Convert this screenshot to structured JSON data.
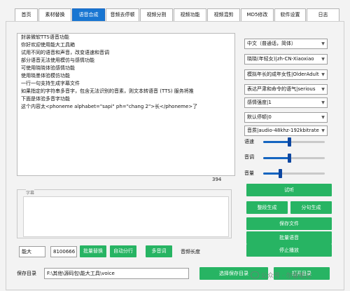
{
  "tabs": [
    {
      "label": "首页",
      "active": false
    },
    {
      "label": "素材替换",
      "active": false
    },
    {
      "label": "语音合成",
      "active": true
    },
    {
      "label": "音频去停顿",
      "active": false
    },
    {
      "label": "视频分割",
      "active": false
    },
    {
      "label": "视频功能",
      "active": false
    },
    {
      "label": "视频混剪",
      "active": false
    },
    {
      "label": "MD5修改",
      "active": false
    },
    {
      "label": "软件设置",
      "active": false
    },
    {
      "label": "日志",
      "active": false
    }
  ],
  "text_input": {
    "lines": [
      "封装微软TTS语音功能",
      "你好欢迎使用能大工具箱",
      "试用不同的语音和声音，改变语速和音调",
      "部分语音无法使用模仿与感情功能",
      "可使用晓晓体验感情功能",
      "使用晓墨体验模仿功能",
      "一行一句支持生成字幕文件",
      "如果指定的字符串多音字，包含无法识别的音素，则文本转语音 (TTS) 服务将推",
      "下面是体验多音字功能",
      "这个内容太<phoneme alphabet=\"sapi\" ph=\"chang 2\">长</phoneme>了"
    ],
    "char_count": "394"
  },
  "subtitle": {
    "label": "字幕",
    "value": ""
  },
  "options": {
    "language": "中文（普通话，简体）",
    "voice": "晓晓(年轻女)|zh-CN-Xiaoxiao",
    "role": "模拟年长的成年女性|OlderAdult",
    "style": "表达严肃和命令的语气|serious",
    "emotion": "感情强度|1",
    "pause": "默认停顿|0",
    "quality": "音质|audio-48khz-192kbitrate"
  },
  "sliders": [
    {
      "label": "语速",
      "value": 0.42
    },
    {
      "label": "音调",
      "value": 0.42
    },
    {
      "label": "音量",
      "value": 0.27
    }
  ],
  "buttons": {
    "preview": "试听",
    "batch_generate": "整段生成",
    "split_generate": "分句生成",
    "save_file": "保存文件",
    "batch_voice": "批量语音",
    "stop_playback": "停止播放",
    "batch_replace": "批量替换",
    "auto_split": "自动分行",
    "multi_voice": "多音词",
    "choose_dir": "选择保存目录",
    "open_dir": "打开目录"
  },
  "bottom": {
    "name_field": "能大",
    "number_field": "8100666",
    "duration_label": "音频长度",
    "save_dir_label": "保存目录",
    "save_dir_value": "F:\\其他\\源码包\\能大工具\\voice"
  },
  "watermark": "公众号 · 尔雷笔记",
  "colors": {
    "accent": "#1976d2",
    "green": "#27b463",
    "slider": "#1565c0"
  }
}
